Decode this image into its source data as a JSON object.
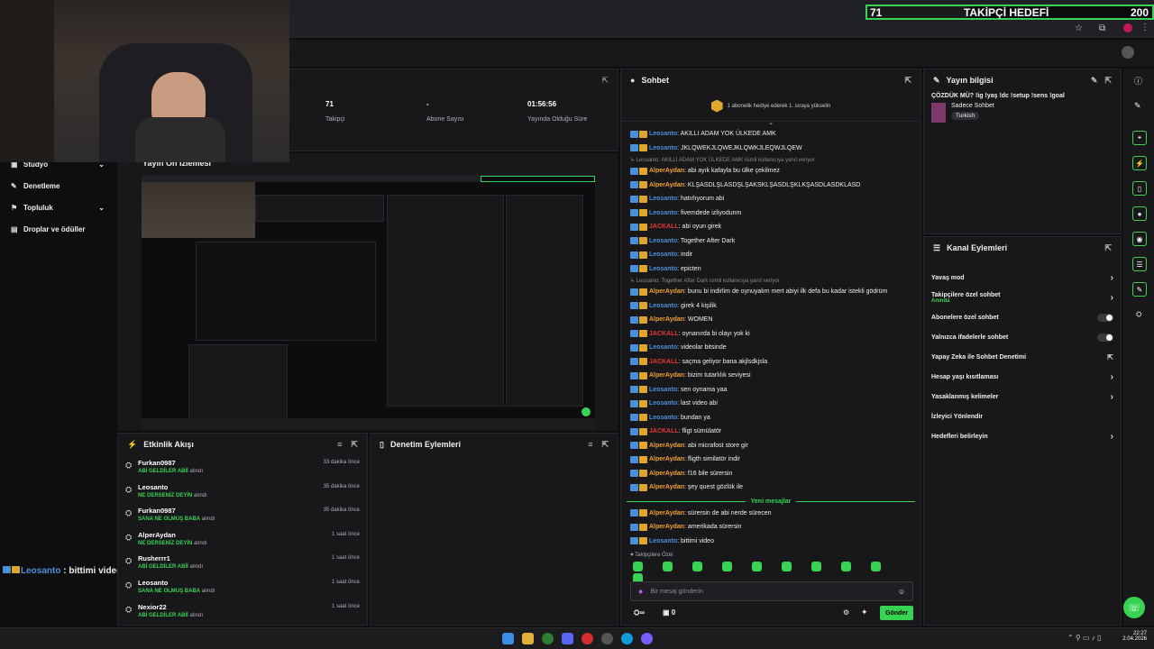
{
  "goal": {
    "current": "71",
    "label": "TAKİPÇİ HEDEFİ",
    "target": "200",
    "progress": 0.355
  },
  "stats": [
    {
      "value": "71",
      "label": "Takipçi"
    },
    {
      "value": "-",
      "label": "Abone Sayısı"
    },
    {
      "value": "01:56:56",
      "label": "Yayında Olduğu Süre"
    }
  ],
  "sidebar": [
    {
      "label": "Stüdyo",
      "icon": "studio-icon"
    },
    {
      "label": "Denetleme",
      "icon": "wrench-icon"
    },
    {
      "label": "Topluluk",
      "icon": "community-icon"
    },
    {
      "label": "Droplar ve ödüller",
      "icon": "drops-icon"
    }
  ],
  "preview_title": "Yayın Ön İzlemesi",
  "overlay_chat": {
    "user": "Leosanto",
    "text": " : bittimi video"
  },
  "activity": {
    "title": "Etkinlik Akışı",
    "items": [
      {
        "name": "Furkan0987",
        "reward": "ABİ GELDİLER ABİİ",
        "suffix": " alındı",
        "time": "33 dakika önce"
      },
      {
        "name": "Leosanto",
        "reward": "NE DERSENİZ DEYİN",
        "suffix": " alındı",
        "time": "35 dakika önce"
      },
      {
        "name": "Furkan0987",
        "reward": "SANA NE OLMUŞ BABA",
        "suffix": " alındı",
        "time": "35 dakika önce"
      },
      {
        "name": "AlperAydan",
        "reward": "NE DERSENİZ DEYİN",
        "suffix": " alındı",
        "time": "1 saat önce"
      },
      {
        "name": "Rusherrr1",
        "reward": "ABİ GELDİLER ABİİ",
        "suffix": " alındı",
        "time": "1 saat önce"
      },
      {
        "name": "Leosanto",
        "reward": "SANA NE OLMUŞ BABA",
        "suffix": " alındı",
        "time": "1 saat önce"
      },
      {
        "name": "Nexior22",
        "reward": "ABİ GELDİLER ABİİ",
        "suffix": " alındı",
        "time": "1 saat önce"
      }
    ]
  },
  "moderation": {
    "title": "Denetim Eylemleri"
  },
  "chat": {
    "title": "Sohbet",
    "pinned": "1 abonelik hediye ederek 1. sıraya yükselin",
    "messages": [
      {
        "type": "msg",
        "user": "Leosanto",
        "color": "#4a90d9",
        "text": ": AKILLI ADAM YOK ÜLKEDE AMK"
      },
      {
        "type": "msg",
        "user": "Leosanto",
        "color": "#4a90d9",
        "text": ": JKLQWEKJLQWEJKLQWKJLEQWJLQEW"
      },
      {
        "type": "sys",
        "text": "↳ Leosanto: AKILLI ADAM YOK ÜLKEDE AMK isimli kullanıcıya yanıt veriyor"
      },
      {
        "type": "msg",
        "user": "AlperAydan",
        "color": "#f0a030",
        "text": ": abi ayık kafayla bu ülke çekilmez"
      },
      {
        "type": "msg",
        "user": "AlperAydan",
        "color": "#f0a030",
        "text": ": KLŞASDLŞLASDŞLŞAKSKLŞASDLŞKLKŞASDLASDKLASD"
      },
      {
        "type": "msg",
        "user": "Leosanto",
        "color": "#4a90d9",
        "text": ": hatırlıyorum abi"
      },
      {
        "type": "msg",
        "user": "Leosanto",
        "color": "#4a90d9",
        "text": ": fivemdede izliyodunm"
      },
      {
        "type": "msg",
        "user": "JACKALL",
        "color": "#e53935",
        "text": ": abi oyun girek"
      },
      {
        "type": "msg",
        "user": "Leosanto",
        "color": "#4a90d9",
        "text": ": Together After Dark"
      },
      {
        "type": "msg",
        "user": "Leosanto",
        "color": "#4a90d9",
        "text": ": indir"
      },
      {
        "type": "msg",
        "user": "Leosanto",
        "color": "#4a90d9",
        "text": ": epicten"
      },
      {
        "type": "sys",
        "text": "↳ Leosanto: Together After Dark isimli kullanıcıya yanıt veriyor"
      },
      {
        "type": "msg",
        "user": "AlperAydan",
        "color": "#f0a030",
        "text": ": bunu bi indirlim de oynuyalım mert abiyi ilk defa bu kadar istekli gödrüm"
      },
      {
        "type": "msg",
        "user": "Leosanto",
        "color": "#4a90d9",
        "text": ": girek 4 kişilik"
      },
      {
        "type": "msg",
        "user": "AlperAydan",
        "color": "#f0a030",
        "text": ": WOMEN"
      },
      {
        "type": "msg",
        "user": "JACKALL",
        "color": "#e53935",
        "text": ": oynanırda bi olayı yok ki"
      },
      {
        "type": "msg",
        "user": "Leosanto",
        "color": "#4a90d9",
        "text": ": videolar bitsinde"
      },
      {
        "type": "msg",
        "user": "JACKALL",
        "color": "#e53935",
        "text": ": saçma geliyor bana akjlsdkjsla"
      },
      {
        "type": "msg",
        "user": "AlperAydan",
        "color": "#f0a030",
        "text": ": bizim tutarlılık seviyesi"
      },
      {
        "type": "msg",
        "user": "Leosanto",
        "color": "#4a90d9",
        "text": ": sen oynama yaa"
      },
      {
        "type": "msg",
        "user": "Leosanto",
        "color": "#4a90d9",
        "text": ": last video abi"
      },
      {
        "type": "msg",
        "user": "Leosanto",
        "color": "#4a90d9",
        "text": ": bundan ya"
      },
      {
        "type": "msg",
        "user": "JACKALL",
        "color": "#e53935",
        "text": ": fligt sümülatör"
      },
      {
        "type": "msg",
        "user": "AlperAydan",
        "color": "#f0a030",
        "text": ": abi micrafost store gir"
      },
      {
        "type": "msg",
        "user": "AlperAydan",
        "color": "#f0a030",
        "text": ": fligth similatör indir"
      },
      {
        "type": "msg",
        "user": "AlperAydan",
        "color": "#f0a030",
        "text": ": f16 bile sürersin"
      },
      {
        "type": "msg",
        "user": "AlperAydan",
        "color": "#f0a030",
        "text": ": şey quest gözlük ile"
      }
    ],
    "new_divider": "Yeni mesajlar",
    "new_messages": [
      {
        "user": "AlperAydan",
        "color": "#f0a030",
        "text": ": sürersin de abi nerde sürecen"
      },
      {
        "user": "AlperAydan",
        "color": "#f0a030",
        "text": ": amerikada sürersin"
      },
      {
        "user": "Leosanto",
        "color": "#4a90d9",
        "text": ": bittimi video"
      }
    ],
    "followers_only": "Takipçilere Özel",
    "input_placeholder": "Bir mesaj gönderin",
    "points": "0",
    "send_label": "Gönder"
  },
  "stream_info": {
    "title": "Yayın bilgisi",
    "stream_title": "ÇÖZDÜK MÜ? !ig !yaş !dc !setup !sens !goal",
    "category": "Sadece Sohbet",
    "tag": "Turkish"
  },
  "channel_actions": {
    "title": "Kanal Eylemleri",
    "items": [
      {
        "label": "Yavaş mod",
        "control": "chevron"
      },
      {
        "label": "Takipçilere özel sohbet",
        "sub": "Anında",
        "control": "chevron"
      },
      {
        "label": "Abonelere özel sohbet",
        "control": "toggle"
      },
      {
        "label": "Yalnızca ifadelerle sohbet",
        "control": "toggle"
      },
      {
        "label": "Yapay Zeka ile Sohbet Denetimi",
        "control": "external"
      },
      {
        "label": "Hesap yaşı kısıtlaması",
        "control": "chevron"
      },
      {
        "label": "Yasaklanmış kelimeler",
        "control": "chevron"
      },
      {
        "label": "İzleyici Yönlendir",
        "control": "none"
      },
      {
        "label": "Hedefleri belirleyin",
        "control": "chevron"
      }
    ]
  },
  "taskbar": {
    "time": "22:27",
    "date": "2.04.2026"
  },
  "colors": {
    "accent": "#39d353",
    "bg": "#0e0e10",
    "panel": "#18181b"
  }
}
